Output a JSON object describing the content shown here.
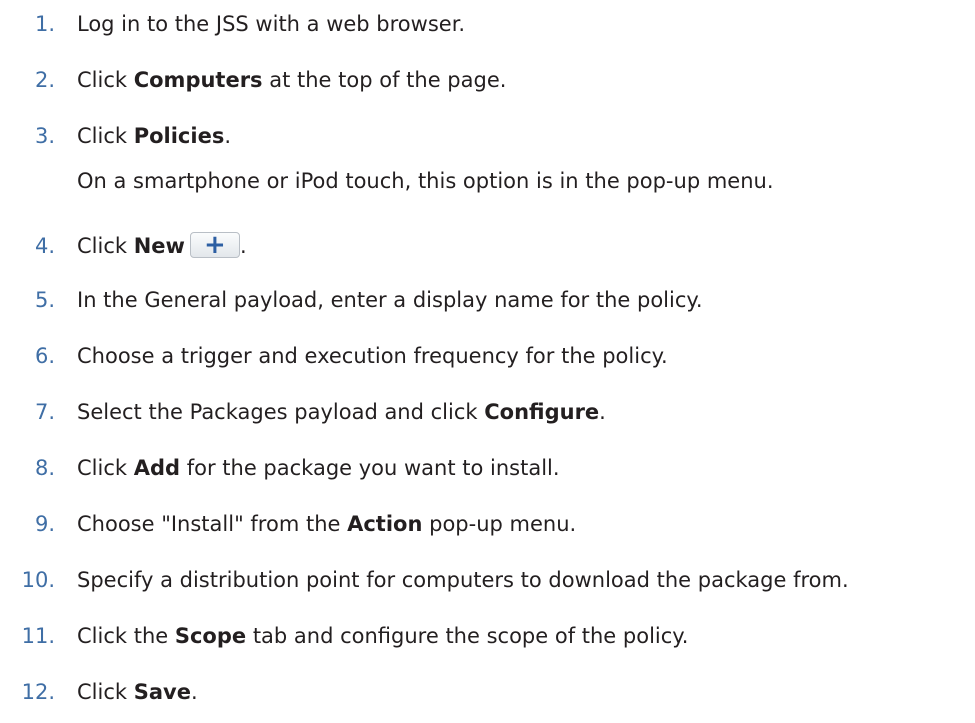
{
  "steps": [
    {
      "num": "1.",
      "pre": "Log in to the JSS with a web browser.",
      "bold": "",
      "post": ""
    },
    {
      "num": "2.",
      "pre": "Click ",
      "bold": "Computers",
      "post": " at the top of the page."
    },
    {
      "num": "3.",
      "pre": "Click ",
      "bold": "Policies",
      "post": ".",
      "note": "On a smartphone or iPod touch, this option is in the pop-up menu."
    },
    {
      "num": "4.",
      "pre": "Click ",
      "bold": "New",
      "post": ".",
      "button_icon": "plus-icon",
      "button_glyph": "+"
    },
    {
      "num": "5.",
      "pre": "In the General payload, enter a display name for the policy.",
      "bold": "",
      "post": ""
    },
    {
      "num": "6.",
      "pre": "Choose a trigger and execution frequency for the policy.",
      "bold": "",
      "post": ""
    },
    {
      "num": "7.",
      "pre": "Select the Packages payload and click ",
      "bold": "Configure",
      "post": "."
    },
    {
      "num": "8.",
      "pre": "Click ",
      "bold": "Add",
      "post": " for the package you want to install."
    },
    {
      "num": "9.",
      "pre": "Choose \"Install\" from the ",
      "bold": "Action",
      "post": " pop-up menu."
    },
    {
      "num": "10.",
      "pre": "Specify a distribution point for computers to download the package from.",
      "bold": "",
      "post": ""
    },
    {
      "num": "11.",
      "pre": "Click the ",
      "bold": "Scope",
      "post": " tab and configure the scope of the policy."
    },
    {
      "num": "12.",
      "pre": "Click ",
      "bold": "Save",
      "post": "."
    }
  ],
  "colors": {
    "step_number": "#3f6ea5",
    "text": "#231f20",
    "button_plus": "#2d5fa3"
  }
}
